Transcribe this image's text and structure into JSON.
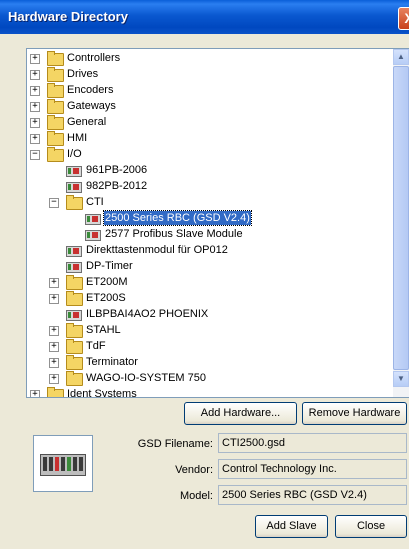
{
  "window": {
    "title": "Hardware Directory",
    "close_glyph": "X"
  },
  "tree": {
    "nodes": [
      {
        "label": "Controllers",
        "kind": "folder",
        "expander": "+"
      },
      {
        "label": "Drives",
        "kind": "folder",
        "expander": "+"
      },
      {
        "label": "Encoders",
        "kind": "folder",
        "expander": "+"
      },
      {
        "label": "Gateways",
        "kind": "folder",
        "expander": "+"
      },
      {
        "label": "General",
        "kind": "folder",
        "expander": "+"
      },
      {
        "label": "HMI",
        "kind": "folder",
        "expander": "+"
      },
      {
        "label": "I/O",
        "kind": "folder",
        "expander": "−"
      },
      {
        "label": "961PB-2006",
        "kind": "device"
      },
      {
        "label": "982PB-2012",
        "kind": "device"
      },
      {
        "label": "CTI",
        "kind": "folder",
        "expander": "−"
      },
      {
        "label": "2500 Series RBC (GSD V2.4)",
        "kind": "device",
        "selected": true
      },
      {
        "label": "2577 Profibus Slave Module",
        "kind": "device"
      },
      {
        "label": "Direkttastenmodul für OP012",
        "kind": "device"
      },
      {
        "label": "DP-Timer",
        "kind": "device"
      },
      {
        "label": "ET200M",
        "kind": "folder",
        "expander": "+"
      },
      {
        "label": "ET200S",
        "kind": "folder",
        "expander": "+"
      },
      {
        "label": "ILBPBAI4AO2 PHOENIX",
        "kind": "device"
      },
      {
        "label": "STAHL",
        "kind": "folder",
        "expander": "+"
      },
      {
        "label": "TdF",
        "kind": "folder",
        "expander": "+"
      },
      {
        "label": "Terminator",
        "kind": "folder",
        "expander": "+"
      },
      {
        "label": "WAGO-IO-SYSTEM 750",
        "kind": "folder",
        "expander": "+"
      },
      {
        "label": "Ident Systems",
        "kind": "folder",
        "expander": "+"
      }
    ],
    "scroll_up_glyph": "▲",
    "scroll_down_glyph": "▼"
  },
  "buttons": {
    "add_hardware": "Add Hardware...",
    "remove_hardware": "Remove Hardware",
    "add_slave": "Add Slave",
    "close": "Close"
  },
  "details": {
    "gsd_filename_label": "GSD Filename:",
    "gsd_filename_value": "CTI2500.gsd",
    "vendor_label": "Vendor:",
    "vendor_value": "Control Technology Inc.",
    "model_label": "Model:",
    "model_value": "2500 Series RBC (GSD V2.4)"
  },
  "colors": {
    "title_bar": "#0a58d0",
    "selection": "#316ac5",
    "folder": "#f4d564"
  }
}
